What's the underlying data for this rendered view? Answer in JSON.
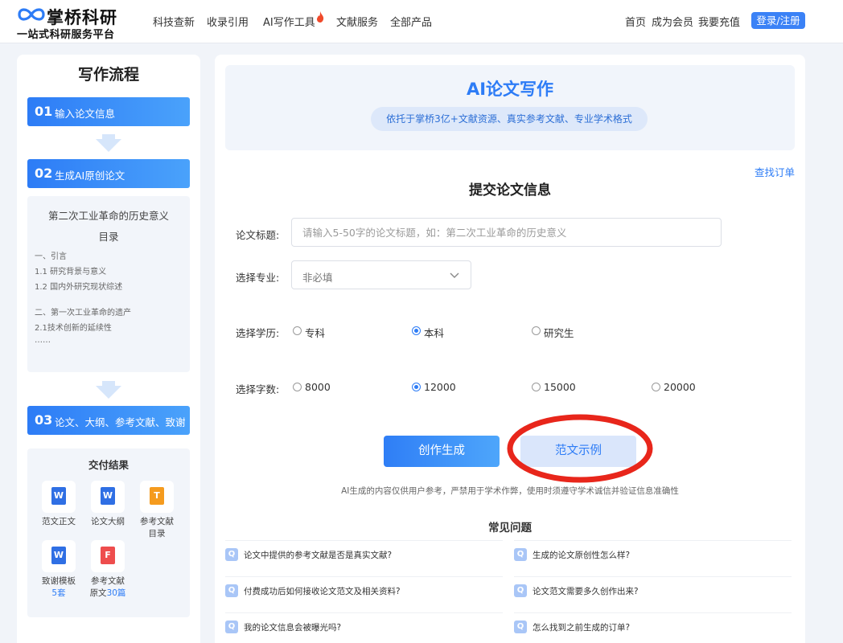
{
  "brand": {
    "name": "掌桥科研",
    "tagline": "一站式科研服务平台"
  },
  "nav_left": [
    "科技查新",
    "收录引用",
    "AI写作工具",
    "文献服务",
    "全部产品"
  ],
  "nav_right": [
    "首页",
    "成为会员",
    "我要充值"
  ],
  "login_label": "登录/注册",
  "sidebar": {
    "title": "写作流程",
    "steps": [
      {
        "num": "01",
        "label": "输入论文信息"
      },
      {
        "num": "02",
        "label": "生成AI原创论文"
      },
      {
        "num": "03",
        "label": "论文、大纲、参考文献、致谢"
      }
    ],
    "outline": {
      "title": "第二次工业革命的历史意义",
      "subtitle": "目录",
      "lines": [
        "一、引言",
        "1.1 研究背景与意义",
        "1.2 国内外研究现状综述",
        "二、第一次工业革命的遗产",
        "2.1技术创新的延续性",
        "……"
      ]
    },
    "results": {
      "title": "交付结果",
      "items": [
        {
          "icon": "W",
          "label": "范文正文",
          "extra": ""
        },
        {
          "icon": "W",
          "label": "论文大纲",
          "extra": ""
        },
        {
          "icon": "T",
          "label": "参考文献目录",
          "extra": ""
        },
        {
          "icon": "W",
          "label": "致谢模板",
          "extra_prefix": "",
          "extra_num": "5套"
        },
        {
          "icon": "F",
          "label": "参考文献原文",
          "extra_num": "30篇"
        }
      ]
    }
  },
  "banner": {
    "title": "AI论文写作",
    "subtitle": "依托于掌桥3亿+文献资源、真实参考文献、专业学术格式"
  },
  "find_order": "查找订单",
  "form": {
    "title": "提交论文信息",
    "title_label": "论文标题:",
    "title_placeholder": "请输入5-50字的论文标题，如：第二次工业革命的历史意义",
    "major_label": "选择专业:",
    "major_value": "非必填",
    "education_label": "选择学历:",
    "education_options": [
      "专科",
      "本科",
      "研究生"
    ],
    "education_selected": 1,
    "words_label": "选择字数:",
    "word_options": [
      "8000",
      "12000",
      "15000",
      "20000"
    ],
    "words_selected": 1,
    "generate_label": "创作生成",
    "sample_label": "范文示例"
  },
  "disclaimer": "AI生成的内容仅供用户参考，严禁用于学术作弊，使用时须遵守学术诚信并验证信息准确性",
  "faq": {
    "title": "常见问题",
    "badge": "Q",
    "items": [
      "论文中提供的参考文献是否是真实文献?",
      "生成的论文原创性怎么样?",
      "付费成功后如何接收论文范文及相关资料?",
      "论文范文需要多久创作出来?",
      "我的论文信息会被曝光吗?",
      "怎么找到之前生成的订单?"
    ]
  },
  "colors": {
    "accent": "#2d7cf6",
    "annotation_circle": "#e8261b"
  }
}
